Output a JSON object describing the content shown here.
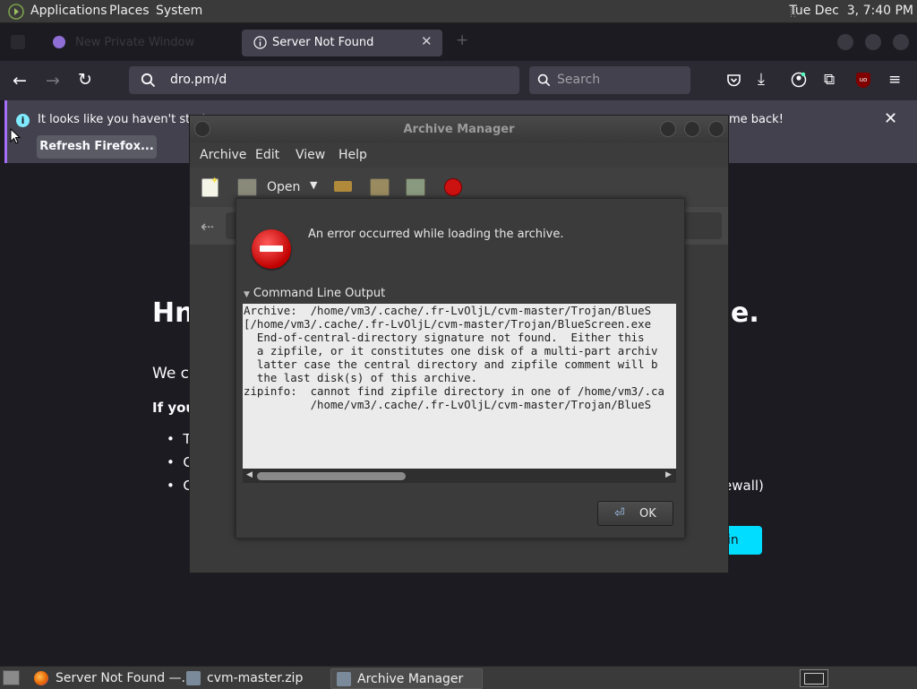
{
  "top_panel": {
    "menus": [
      "Applications",
      "Places",
      "System"
    ],
    "clock": "Tue Dec  3, 7:40 PM"
  },
  "firefox": {
    "inactive_tab_label": "New Private Window",
    "active_tab_label": "Server Not Found",
    "url": "dro.pm/d",
    "search_placeholder": "Search",
    "notification": {
      "text_start": "It looks like you haven't start",
      "text_end": "me back!",
      "button_label": "Refresh Firefox..."
    },
    "page": {
      "heading_left": "Hn",
      "heading_right": "e.",
      "we_can": "We ca",
      "if_you": "If you",
      "bullets": [
        "Tr",
        "Cl",
        "Cl"
      ],
      "firewall_fragment": "ewall)",
      "try_again_fragment": "in"
    }
  },
  "archive_manager": {
    "title": "Archive Manager",
    "menus": [
      "Archive",
      "Edit",
      "View",
      "Help"
    ],
    "open_label": "Open"
  },
  "error_dialog": {
    "message": "An error occurred while loading the archive.",
    "expander_label": "Command Line Output",
    "output_lines": [
      "Archive:  /home/vm3/.cache/.fr-LvOljL/cvm-master/Trojan/BlueS",
      "[/home/vm3/.cache/.fr-LvOljL/cvm-master/Trojan/BlueScreen.exe",
      "  End-of-central-directory signature not found.  Either this",
      "  a zipfile, or it constitutes one disk of a multi-part archiv",
      "  latter case the central directory and zipfile comment will b",
      "  the last disk(s) of this archive.",
      "zipinfo:  cannot find zipfile directory in one of /home/vm3/.ca",
      "          /home/vm3/.cache/.fr-LvOljL/cvm-master/Trojan/BlueS"
    ],
    "ok_label": "OK"
  },
  "taskbar": {
    "tasks": [
      {
        "label": "Server Not Found —...",
        "icon": "firefox-icon"
      },
      {
        "label": "cvm-master.zip",
        "icon": "archive-icon"
      },
      {
        "label": "Archive Manager",
        "icon": "archive-icon"
      }
    ]
  }
}
